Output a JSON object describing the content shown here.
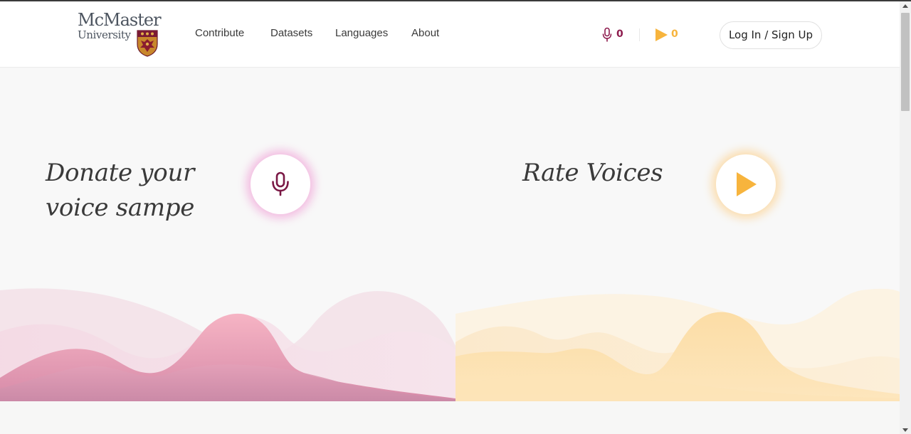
{
  "brand": {
    "name_line1": "McMaster",
    "name_line2": "University",
    "logo_icon": "crest-icon"
  },
  "nav": {
    "items": [
      {
        "label": "Contribute"
      },
      {
        "label": "Datasets"
      },
      {
        "label": "Languages"
      },
      {
        "label": "About"
      }
    ]
  },
  "stats": {
    "recordings": {
      "icon": "microphone-icon",
      "count": "0",
      "color": "#8e1c4e"
    },
    "validations": {
      "icon": "play-icon",
      "count": "0",
      "color": "#f7b43d"
    }
  },
  "auth": {
    "login_label": "Log In / Sign Up"
  },
  "hero": {
    "speak": {
      "title_line1": "Donate your",
      "title_line2": "voice sampe",
      "button_icon": "microphone-icon",
      "accent": "#8e1c4e"
    },
    "listen": {
      "title": "Rate Voices",
      "button_icon": "play-icon",
      "accent": "#f7b43d"
    }
  }
}
